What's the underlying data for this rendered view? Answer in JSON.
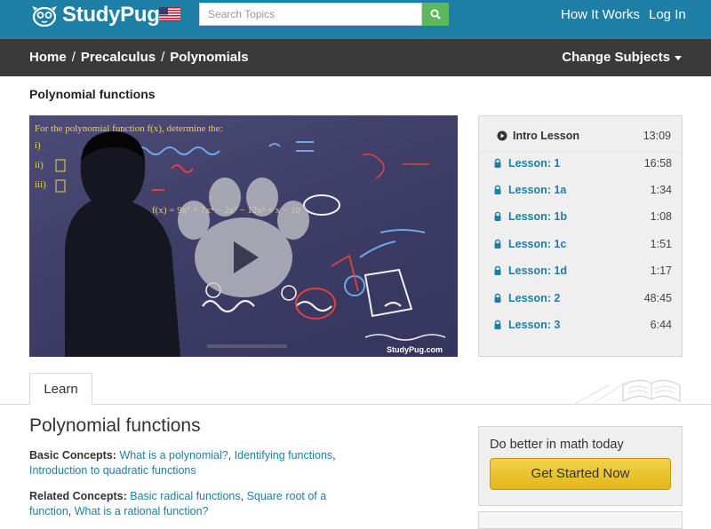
{
  "header": {
    "brand": "StudyPug",
    "search_placeholder": "Search Topics",
    "nav": [
      "How It Works",
      "Log In"
    ]
  },
  "breadcrumb": [
    "Home",
    "Precalculus",
    "Polynomials"
  ],
  "change_subjects": "Change Subjects",
  "page_heading": "Polynomial functions",
  "video": {
    "watermark": "StudyPug.com",
    "board_lines": [
      "For the polynomial function f(x), determine the:",
      "i)",
      "ii)",
      "iii)",
      "f(x) = 9x⁵ + 7x⁴ − 2x³ − 12x² + x − 10"
    ]
  },
  "lessons": [
    {
      "label": "Intro Lesson",
      "duration": "13:09",
      "icon": "play-icon"
    },
    {
      "label": "Lesson: 1",
      "duration": "16:58",
      "icon": "lock-icon"
    },
    {
      "label": "Lesson: 1a",
      "duration": "1:34",
      "icon": "lock-icon"
    },
    {
      "label": "Lesson: 1b",
      "duration": "1:08",
      "icon": "lock-icon"
    },
    {
      "label": "Lesson: 1c",
      "duration": "1:51",
      "icon": "lock-icon"
    },
    {
      "label": "Lesson: 1d",
      "duration": "1:17",
      "icon": "lock-icon"
    },
    {
      "label": "Lesson: 2",
      "duration": "48:45",
      "icon": "lock-icon"
    },
    {
      "label": "Lesson: 3",
      "duration": "6:44",
      "icon": "lock-icon"
    }
  ],
  "tabs": [
    "Learn"
  ],
  "content": {
    "title": "Polynomial functions",
    "basic_label": "Basic Concepts:",
    "basic_links": [
      "What is a polynomial?",
      "Identifying functions",
      "Introduction to quadratic functions"
    ],
    "related_label": "Related Concepts:",
    "related_links": [
      "Basic radical functions",
      "Square root of a function",
      "What is a rational function?"
    ]
  },
  "cta": {
    "title": "Do better in math today",
    "button": "Get Started Now"
  },
  "colors": {
    "header": "#1d7fa6",
    "crumbbar": "#3a3a3a",
    "search_button": "#5cb85c",
    "cta_button": "#e8c22c"
  }
}
